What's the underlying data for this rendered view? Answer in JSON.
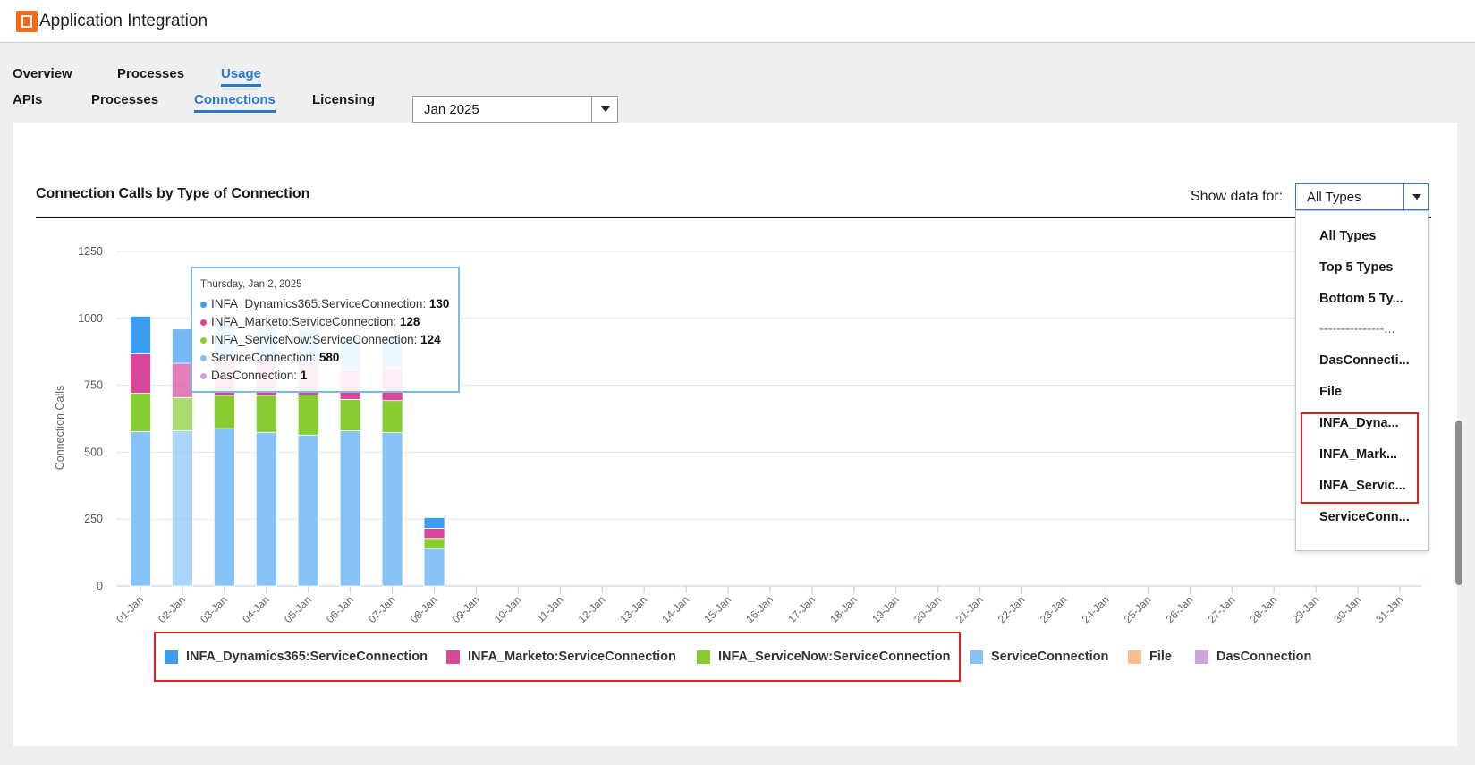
{
  "app": {
    "title": "Application Integration",
    "logo_icon": "application-integration-icon",
    "logo_color": "#f26b1d"
  },
  "nav": {
    "primary_tabs": [
      {
        "label": "Overview",
        "active": false
      },
      {
        "label": "Processes",
        "active": false
      },
      {
        "label": "Usage",
        "active": true
      }
    ],
    "secondary_tabs": [
      {
        "label": "APIs",
        "active": false
      },
      {
        "label": "Processes",
        "active": false
      },
      {
        "label": "Connections",
        "active": true
      },
      {
        "label": "Licensing",
        "active": false
      }
    ],
    "accent_color": "#2a7ad2"
  },
  "month_select": {
    "value": "Jan 2025"
  },
  "panel": {
    "title": "Connection Calls by Type of Connection",
    "show_data_label": "Show data for:",
    "type_select": {
      "value": "All Types"
    },
    "dropdown_options": [
      "All Types",
      "Top 5 Types",
      "Bottom 5 Ty...",
      "---------------...",
      "DasConnecti...",
      "File",
      "INFA_Dyna...",
      "INFA_Mark...",
      "INFA_Servic...",
      "ServiceConn..."
    ],
    "highlight_color": "#e02020"
  },
  "tooltip": {
    "date": "Thursday, Jan 2, 2025",
    "rows": [
      {
        "label": "INFA_Dynamics365:ServiceConnection:",
        "value": "130",
        "color": "#3b9cf0"
      },
      {
        "label": "INFA_Marketo:ServiceConnection:",
        "value": "128",
        "color": "#d9479b"
      },
      {
        "label": "INFA_ServiceNow:ServiceConnection:",
        "value": "124",
        "color": "#86cc32"
      },
      {
        "label": "ServiceConnection:",
        "value": "580",
        "color": "#88c3f7"
      },
      {
        "label": "DasConnection:",
        "value": "1",
        "color": "#cfa4dc"
      }
    ]
  },
  "chart_data": {
    "type": "bar",
    "stacked": true,
    "ylabel": "Connection Calls",
    "xlabel": "",
    "ylim": [
      0,
      1250
    ],
    "yticks": [
      0,
      250,
      500,
      750,
      1000,
      1250
    ],
    "grid": true,
    "legend_position": "bottom",
    "hovered_category": "02-Jan",
    "categories": [
      "01-Jan",
      "02-Jan",
      "03-Jan",
      "04-Jan",
      "05-Jan",
      "06-Jan",
      "07-Jan",
      "08-Jan",
      "09-Jan",
      "10-Jan",
      "11-Jan",
      "12-Jan",
      "13-Jan",
      "14-Jan",
      "15-Jan",
      "16-Jan",
      "17-Jan",
      "18-Jan",
      "19-Jan",
      "20-Jan",
      "21-Jan",
      "22-Jan",
      "23-Jan",
      "24-Jan",
      "25-Jan",
      "26-Jan",
      "27-Jan",
      "28-Jan",
      "29-Jan",
      "30-Jan",
      "31-Jan"
    ],
    "series": [
      {
        "name": "ServiceConnection",
        "color": "#88c3f7",
        "values": [
          577,
          580,
          588,
          574,
          564,
          580,
          573,
          140,
          0,
          0,
          0,
          0,
          0,
          0,
          0,
          0,
          0,
          0,
          0,
          0,
          0,
          0,
          0,
          0,
          0,
          0,
          0,
          0,
          0,
          0,
          0
        ]
      },
      {
        "name": "INFA_ServiceNow:ServiceConnection",
        "color": "#86cc32",
        "values": [
          143,
          124,
          124,
          138,
          150,
          117,
          120,
          38,
          0,
          0,
          0,
          0,
          0,
          0,
          0,
          0,
          0,
          0,
          0,
          0,
          0,
          0,
          0,
          0,
          0,
          0,
          0,
          0,
          0,
          0,
          0
        ]
      },
      {
        "name": "INFA_Marketo:ServiceConnection",
        "color": "#d9479b",
        "values": [
          148,
          128,
          140,
          130,
          125,
          110,
          122,
          38,
          0,
          0,
          0,
          0,
          0,
          0,
          0,
          0,
          0,
          0,
          0,
          0,
          0,
          0,
          0,
          0,
          0,
          0,
          0,
          0,
          0,
          0,
          0
        ]
      },
      {
        "name": "INFA_Dynamics365:ServiceConnection",
        "color": "#3b9cf0",
        "values": [
          140,
          130,
          130,
          125,
          120,
          125,
          120,
          40,
          0,
          0,
          0,
          0,
          0,
          0,
          0,
          0,
          0,
          0,
          0,
          0,
          0,
          0,
          0,
          0,
          0,
          0,
          0,
          0,
          0,
          0,
          0
        ]
      },
      {
        "name": "File",
        "color": "#f9bd92",
        "values": [
          0,
          0,
          0,
          0,
          0,
          0,
          0,
          0,
          0,
          0,
          0,
          0,
          0,
          0,
          0,
          0,
          0,
          0,
          0,
          0,
          0,
          0,
          0,
          0,
          0,
          0,
          0,
          0,
          0,
          0,
          0
        ]
      },
      {
        "name": "DasConnection",
        "color": "#cfa4dc",
        "values": [
          0,
          1,
          0,
          0,
          0,
          0,
          0,
          0,
          0,
          0,
          0,
          0,
          0,
          0,
          0,
          0,
          0,
          0,
          0,
          0,
          0,
          0,
          0,
          0,
          0,
          0,
          0,
          0,
          0,
          0,
          0
        ]
      }
    ],
    "legend_order": [
      "INFA_Dynamics365:ServiceConnection",
      "INFA_Marketo:ServiceConnection",
      "INFA_ServiceNow:ServiceConnection",
      "ServiceConnection",
      "File",
      "DasConnection"
    ]
  }
}
